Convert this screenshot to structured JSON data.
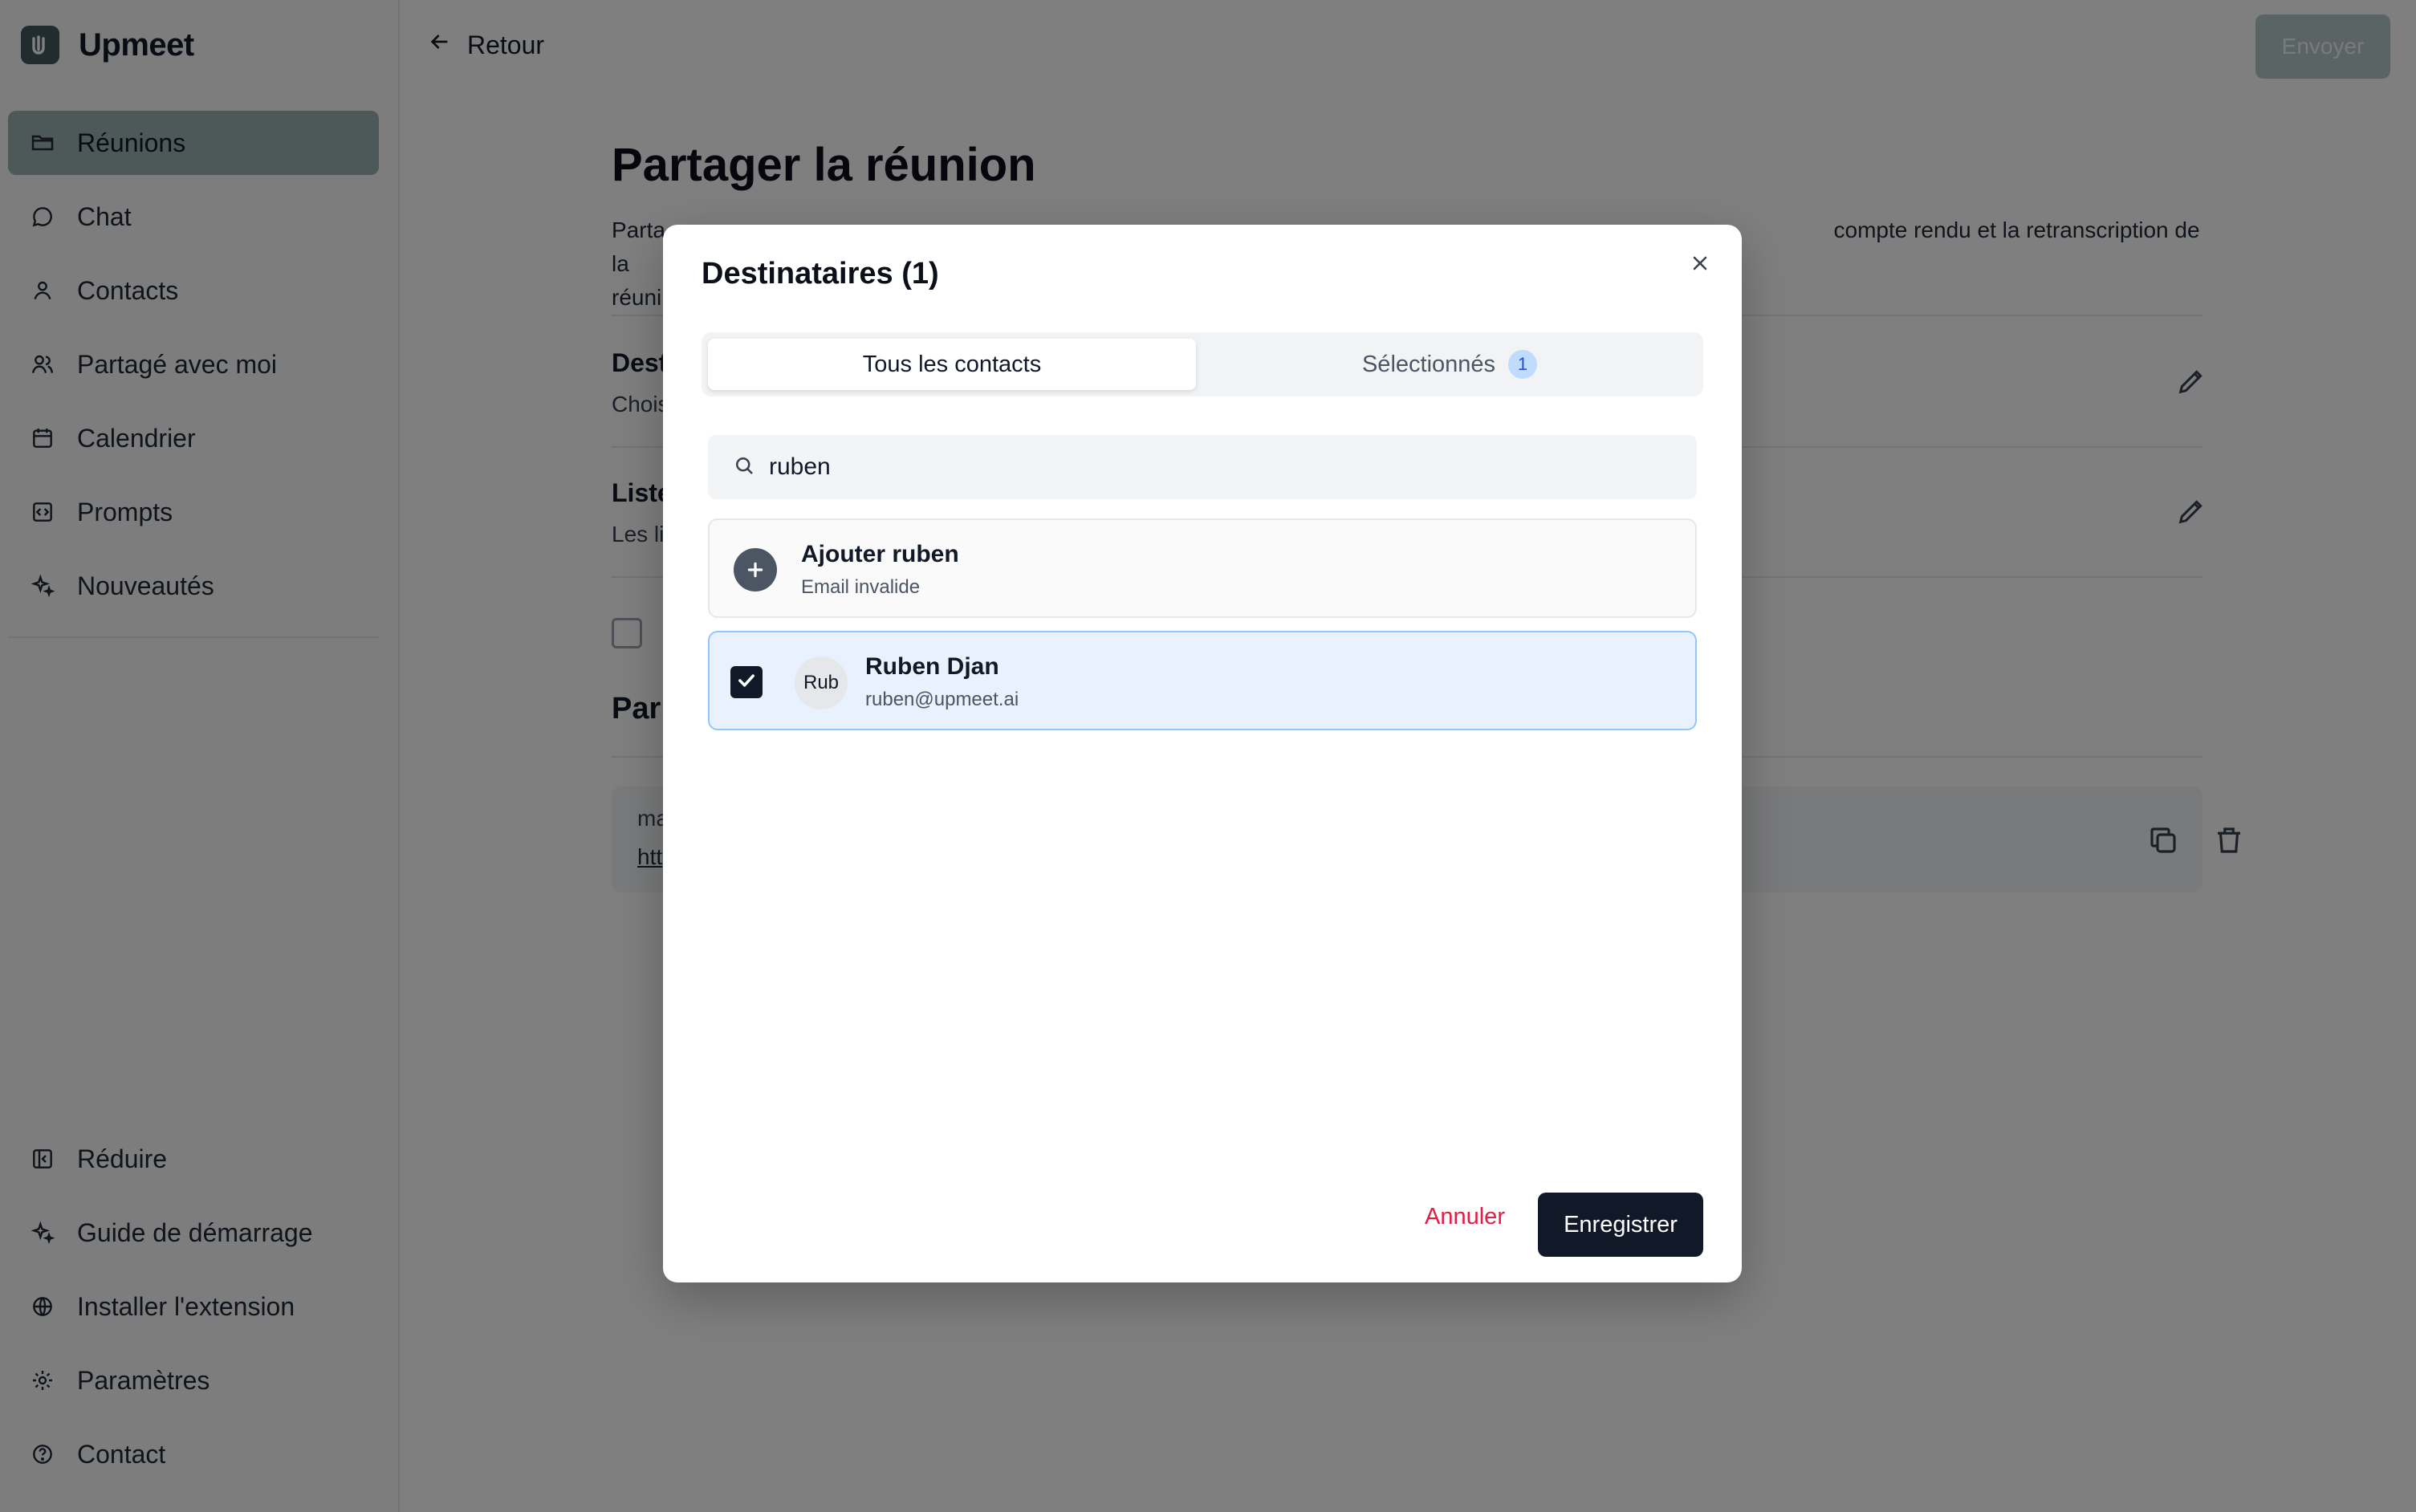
{
  "app": {
    "name": "Upmeet",
    "logo_icon": "upmeet-logo-icon"
  },
  "sidebar": {
    "items": [
      {
        "label": "Réunions",
        "icon": "folder-icon",
        "active": true
      },
      {
        "label": "Chat",
        "icon": "chat-bubble-icon"
      },
      {
        "label": "Contacts",
        "icon": "user-icon"
      },
      {
        "label": "Partagé avec moi",
        "icon": "users-icon"
      },
      {
        "label": "Calendrier",
        "icon": "calendar-icon"
      },
      {
        "label": "Prompts",
        "icon": "code-square-icon"
      },
      {
        "label": "Nouveautés",
        "icon": "sparkles-icon"
      }
    ],
    "bottom_items": [
      {
        "label": "Réduire",
        "icon": "collapse-panel-icon"
      },
      {
        "label": "Guide de démarrage",
        "icon": "sparkles-icon"
      },
      {
        "label": "Installer l'extension",
        "icon": "globe-icon"
      },
      {
        "label": "Paramètres",
        "icon": "gear-icon"
      },
      {
        "label": "Contact",
        "icon": "help-circle-icon"
      }
    ]
  },
  "header": {
    "back_label": "Retour",
    "send_label": "Envoyer"
  },
  "page": {
    "title": "Partager la réunion",
    "desc_line1_start": "Parta",
    "desc_line1_end": "compte rendu et la retranscription de la",
    "desc_line2_start": "réuni",
    "sections": [
      {
        "title": "Dest",
        "subtitle": "Chois"
      },
      {
        "title": "Liste",
        "subtitle": "Les li"
      }
    ],
    "section3_title": "Par",
    "link_box": {
      "line1": "ma",
      "line2": "htt"
    }
  },
  "modal": {
    "title": "Destinataires (1)",
    "tabs": [
      {
        "label": "Tous les contacts",
        "active": true
      },
      {
        "label": "Sélectionnés",
        "badge": "1"
      }
    ],
    "search": {
      "value": "ruben",
      "placeholder": ""
    },
    "add_row": {
      "name": "Ajouter ruben",
      "sub": "Email invalide"
    },
    "contact_row": {
      "initials": "Rub",
      "name": "Ruben Djan",
      "email": "ruben@upmeet.ai",
      "checked": true
    },
    "cancel_label": "Annuler",
    "save_label": "Enregistrer"
  },
  "colors": {
    "accent": "#9ab0b2",
    "brand": "#41585a",
    "danger": "#e11d48",
    "primary_button": "#111827",
    "selected_row": "#e8f1fd"
  }
}
